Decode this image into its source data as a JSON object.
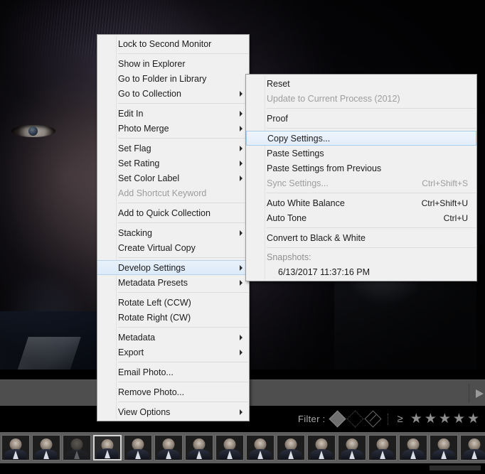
{
  "app": {
    "photo_alt": "portrait-photo"
  },
  "toolbar": {
    "chevron_icon": "chevron-right-icon"
  },
  "filter_bar": {
    "label": "Filter :",
    "flags": [
      "flag-picked-icon",
      "flag-unflagged-icon",
      "flag-rejected-icon"
    ],
    "comparator": "≥",
    "star_icon": "★",
    "star_count": 5,
    "stars_filled": 0
  },
  "context_menu": {
    "items": [
      {
        "label": "Lock to Second Monitor",
        "type": "item"
      },
      {
        "type": "separator"
      },
      {
        "label": "Show in Explorer",
        "type": "item"
      },
      {
        "label": "Go to Folder in Library",
        "type": "item"
      },
      {
        "label": "Go to Collection",
        "type": "submenu"
      },
      {
        "type": "separator"
      },
      {
        "label": "Edit In",
        "type": "submenu"
      },
      {
        "label": "Photo Merge",
        "type": "submenu"
      },
      {
        "type": "separator"
      },
      {
        "label": "Set Flag",
        "type": "submenu"
      },
      {
        "label": "Set Rating",
        "type": "submenu"
      },
      {
        "label": "Set Color Label",
        "type": "submenu"
      },
      {
        "label": "Add Shortcut Keyword",
        "type": "item",
        "disabled": true
      },
      {
        "type": "separator"
      },
      {
        "label": "Add to Quick Collection",
        "type": "item"
      },
      {
        "type": "separator"
      },
      {
        "label": "Stacking",
        "type": "submenu"
      },
      {
        "label": "Create Virtual Copy",
        "type": "item"
      },
      {
        "type": "separator"
      },
      {
        "label": "Develop Settings",
        "type": "submenu",
        "highlighted": true
      },
      {
        "label": "Metadata Presets",
        "type": "submenu"
      },
      {
        "type": "separator"
      },
      {
        "label": "Rotate Left (CCW)",
        "type": "item"
      },
      {
        "label": "Rotate Right (CW)",
        "type": "item"
      },
      {
        "type": "separator"
      },
      {
        "label": "Metadata",
        "type": "submenu"
      },
      {
        "label": "Export",
        "type": "submenu"
      },
      {
        "type": "separator"
      },
      {
        "label": "Email Photo...",
        "type": "item"
      },
      {
        "type": "separator"
      },
      {
        "label": "Remove Photo...",
        "type": "item"
      },
      {
        "type": "separator"
      },
      {
        "label": "View Options",
        "type": "submenu"
      }
    ]
  },
  "develop_submenu": {
    "items": [
      {
        "label": "Reset",
        "type": "item",
        "accel": ""
      },
      {
        "label": "Update to Current Process (2012)",
        "type": "item",
        "disabled": true,
        "accel": ""
      },
      {
        "type": "separator"
      },
      {
        "label": "Proof",
        "type": "item",
        "accel": ""
      },
      {
        "type": "separator"
      },
      {
        "label": "Copy Settings...",
        "type": "item",
        "accel": "",
        "selected": true
      },
      {
        "label": "Paste Settings",
        "type": "item",
        "accel": ""
      },
      {
        "label": "Paste Settings from Previous",
        "type": "item",
        "accel": ""
      },
      {
        "label": "Sync Settings...",
        "type": "item",
        "disabled": true,
        "accel": "Ctrl+Shift+S"
      },
      {
        "type": "separator"
      },
      {
        "label": "Auto White Balance",
        "type": "item",
        "accel": "Ctrl+Shift+U"
      },
      {
        "label": "Auto Tone",
        "type": "item",
        "accel": "Ctrl+U"
      },
      {
        "type": "separator"
      },
      {
        "label": "Convert to Black & White",
        "type": "item",
        "accel": ""
      },
      {
        "type": "separator"
      },
      {
        "label": "Snapshots:",
        "type": "note"
      },
      {
        "label": "6/13/2017 11:37:16 PM",
        "type": "snapshot"
      }
    ]
  },
  "filmstrip": {
    "selected_index": 3,
    "thumbs": [
      {
        "dim": false
      },
      {
        "dim": false
      },
      {
        "dim": true
      },
      {
        "dim": false
      },
      {
        "dim": false
      },
      {
        "dim": false
      },
      {
        "dim": false
      },
      {
        "dim": false
      },
      {
        "dim": false
      },
      {
        "dim": false
      },
      {
        "dim": false
      },
      {
        "dim": false
      },
      {
        "dim": false
      },
      {
        "dim": false
      },
      {
        "dim": false
      },
      {
        "dim": false
      }
    ]
  },
  "colors": {
    "menu_bg": "#f0f0f0",
    "menu_border": "#9a9a9a",
    "highlight": "#dceaf8",
    "highlight_border": "#a8cdee",
    "disabled_text": "#9d9d9d",
    "toolbar_bg": "#4e4e4e",
    "filmstrip_bg": "#5d5d5d",
    "panel_black": "#000000"
  }
}
